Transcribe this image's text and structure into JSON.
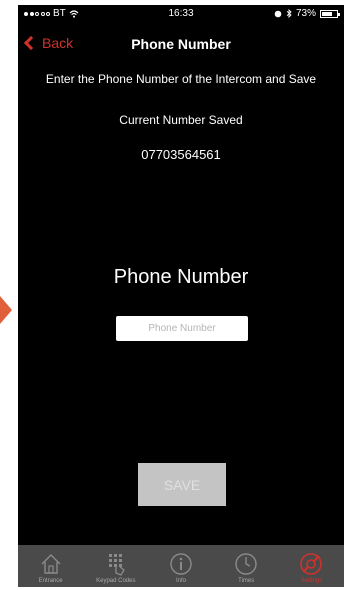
{
  "status_bar": {
    "carrier": "BT",
    "time": "16:33",
    "battery": "73%"
  },
  "nav": {
    "back_label": "Back",
    "title": "Phone Number"
  },
  "content": {
    "instructions": "Enter the Phone Number of the Intercom and Save",
    "current_label": "Current Number Saved",
    "current_number": "07703564561",
    "field_heading": "Phone Number",
    "input_placeholder": "Phone Number",
    "save_label": "SAVE"
  },
  "tabs": [
    {
      "label": "Entrance",
      "icon": "house-icon",
      "active": false
    },
    {
      "label": "Keypad Codes",
      "icon": "keypad-icon",
      "active": false
    },
    {
      "label": "Info",
      "icon": "info-icon",
      "active": false
    },
    {
      "label": "Times",
      "icon": "clock-icon",
      "active": false
    },
    {
      "label": "Settings",
      "icon": "settings-icon",
      "active": true
    }
  ],
  "colors": {
    "accent": "#d0312d",
    "background": "#000000",
    "tab_bar": "#4a4a4a",
    "save_disabled": "#c4c4c4"
  }
}
